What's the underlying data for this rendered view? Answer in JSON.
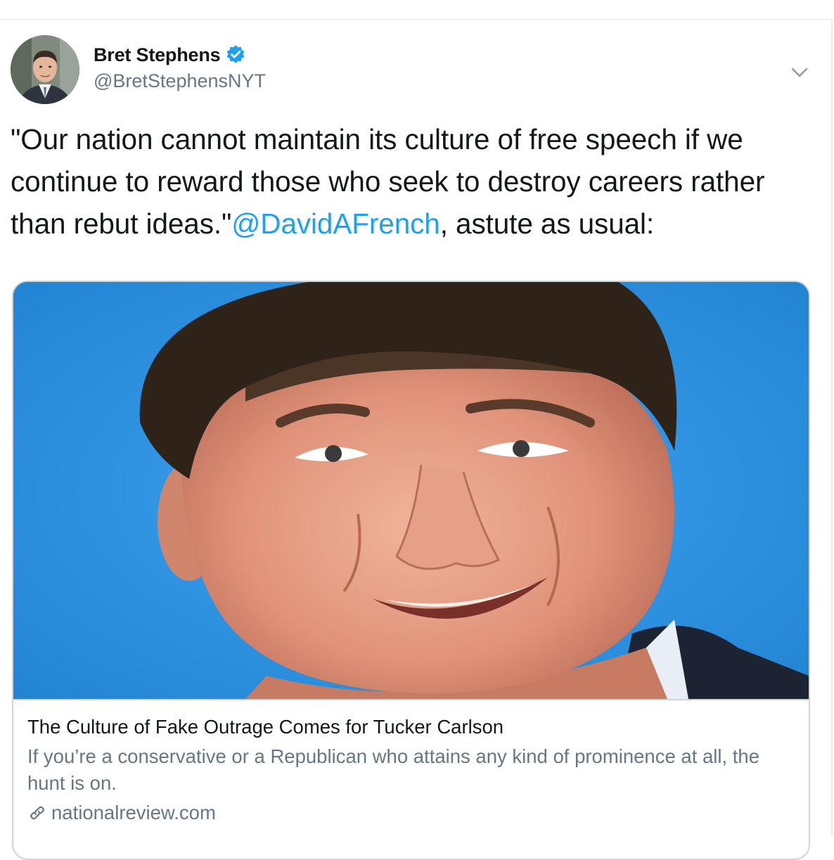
{
  "author": {
    "name": "Bret Stephens",
    "handle": "@BretStephensNYT",
    "verified": true,
    "avatar_icon": "profile-photo"
  },
  "tweet": {
    "text_before": "\"Our nation cannot maintain its culture of free speech if we continue to reward those who seek to destroy careers rather than rebut ideas.\"",
    "mention": "@DavidAFrench",
    "text_after": ", astute as usual:"
  },
  "card": {
    "image_icon": "article-photo",
    "title": "The Culture of Fake Outrage Comes for Tucker Carlson",
    "description": "If you’re a conservative or a Republican who attains any kind of prominence at all, the hunt is on.",
    "domain": "nationalreview.com",
    "link_icon": "link-icon"
  },
  "colors": {
    "link_blue": "#1da1f2",
    "secondary_gray": "#657786",
    "border": "#ccd6dd",
    "photo_background": "#2f93e0"
  }
}
